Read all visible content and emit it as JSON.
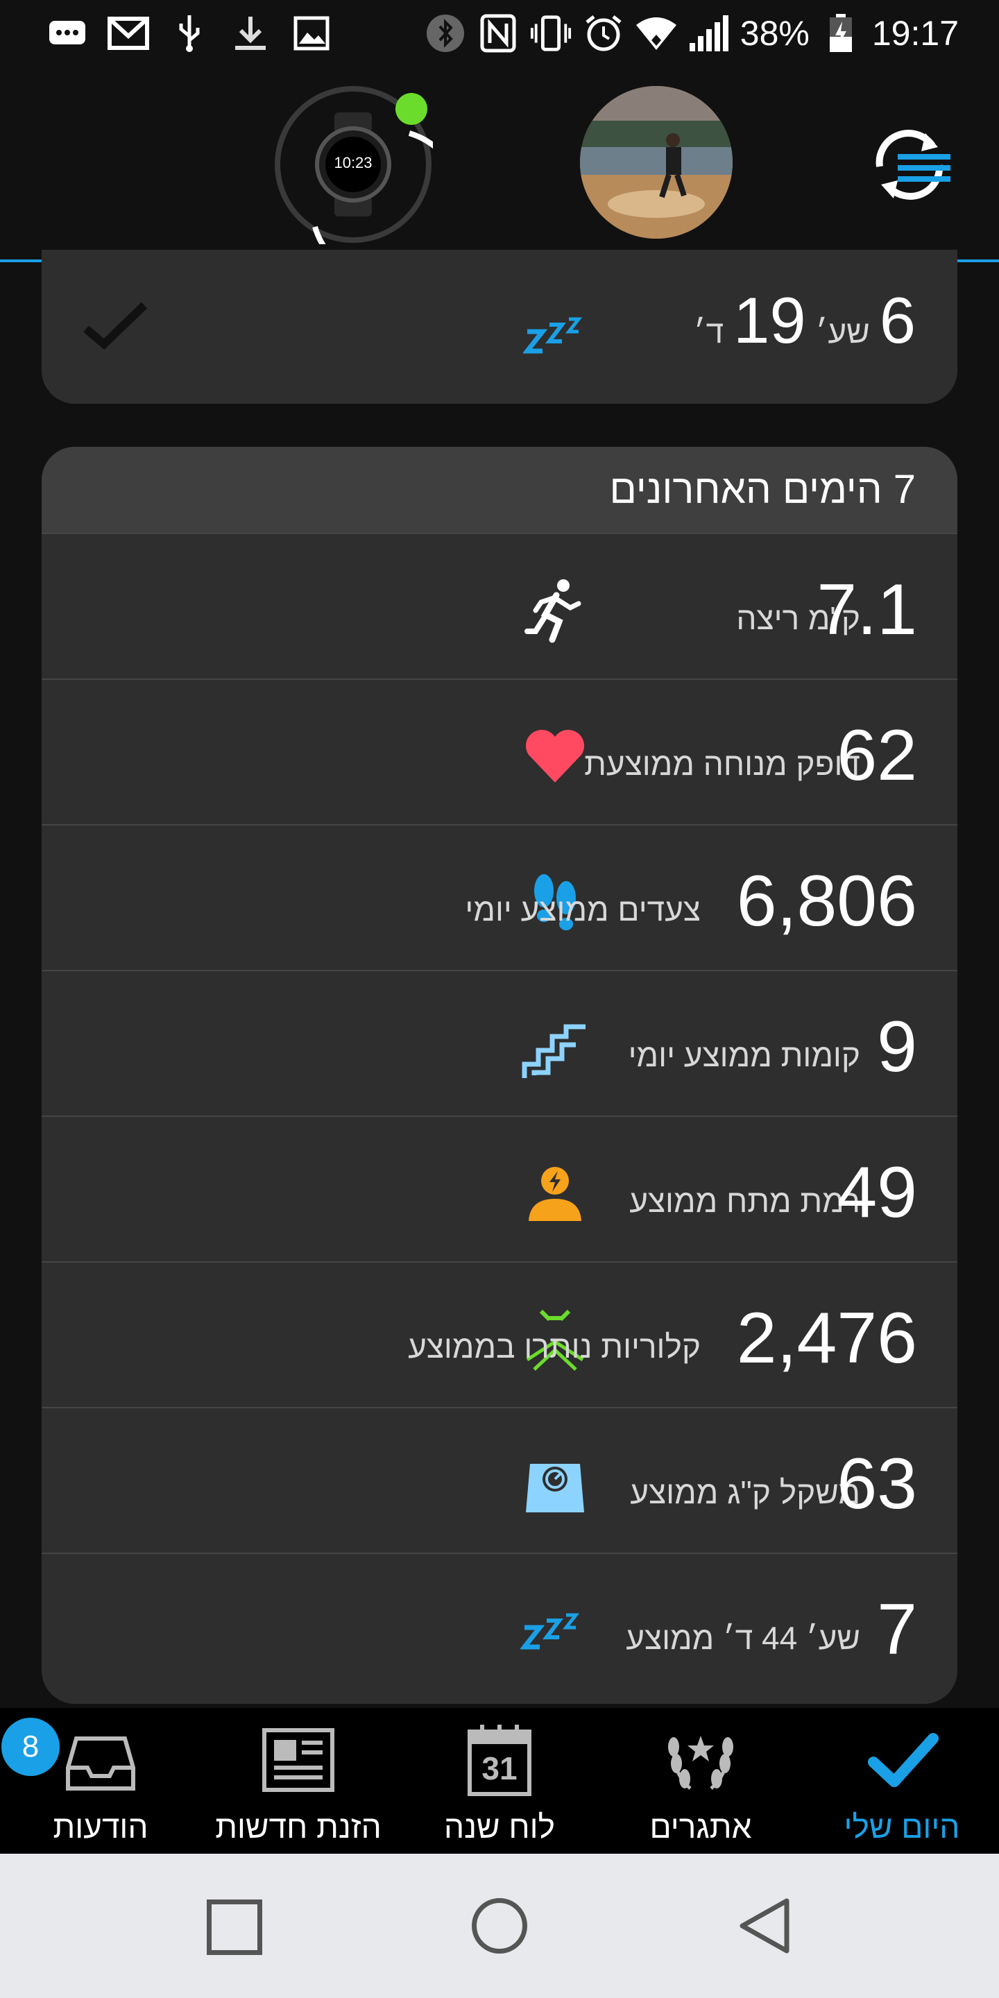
{
  "status_bar": {
    "battery": "38%",
    "time": "19:17"
  },
  "header": {
    "watch_time": "10:23"
  },
  "sleep_card": {
    "value": "6",
    "unit_hours": "שע׳",
    "minutes": "19",
    "unit_minutes": "ד׳"
  },
  "week_card": {
    "title": "7 הימים האחרונים",
    "rows": [
      {
        "value": "7.1",
        "label": "ק\"מ ריצה",
        "icon": "running-icon"
      },
      {
        "value": "62",
        "label": "דופק מנוחה ממוצעת",
        "icon": "heart-icon"
      },
      {
        "value": "6,806",
        "label": "צעדים ממוצע יומי",
        "icon": "footsteps-icon"
      },
      {
        "value": "9",
        "label": "קומות ממוצע יומי",
        "icon": "stairs-icon"
      },
      {
        "value": "49",
        "label": "רמת מתח ממוצע",
        "icon": "stress-icon"
      },
      {
        "value": "2,476",
        "label": "קלוריות נותרו בממוצע",
        "icon": "calories-icon"
      },
      {
        "value": "63",
        "label": "משקל ק\"ג ממוצע",
        "icon": "scale-icon"
      },
      {
        "value": "7",
        "label": "שע׳ 44 ד׳ ממוצע",
        "icon": "sleep-icon"
      }
    ]
  },
  "bottom_nav": {
    "items": [
      {
        "label": "הודעות",
        "badge": "8"
      },
      {
        "label": "הזנת חדשות"
      },
      {
        "label": "לוח שנה",
        "calendar_day": "31"
      },
      {
        "label": "אתגרים"
      },
      {
        "label": "היום שלי"
      }
    ]
  },
  "colors": {
    "accent": "#1aa0e6",
    "card_bg": "#2e2e2e",
    "card_header_bg": "#3f3f3f",
    "heart": "#ff4a62",
    "stress": "#f7a21b",
    "sleep": "#1aa0e6",
    "connected_dot": "#6bdc2b"
  }
}
